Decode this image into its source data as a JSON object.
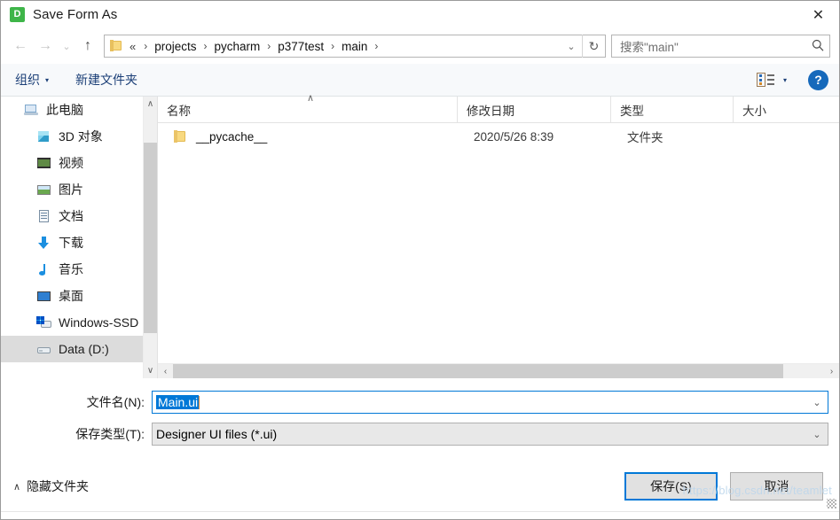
{
  "window": {
    "title": "Save Form As",
    "app_icon": "designer-icon",
    "app_icon_letter": "D",
    "close_label": "✕"
  },
  "nav": {
    "back": "←",
    "forward": "→",
    "history_caret": "⌄",
    "up": "↑",
    "address": {
      "folder_icon": "folder-icon",
      "prefix": "«",
      "crumbs": [
        "projects",
        "pycharm",
        "p377test",
        "main"
      ],
      "separator": "›",
      "dropdown": "⌄"
    },
    "refresh": "↻",
    "search": {
      "placeholder": "搜索\"main\"",
      "icon": "search-icon"
    }
  },
  "toolbar": {
    "organize": "组织",
    "organize_caret": "▾",
    "new_folder": "新建文件夹",
    "view_caret": "▾",
    "help": "?"
  },
  "sidebar": {
    "items": [
      {
        "label": "此电脑",
        "icon": "computer-icon",
        "indent": false,
        "selected": false
      },
      {
        "label": "3D 对象",
        "icon": "3d-objects-icon",
        "indent": true,
        "selected": false
      },
      {
        "label": "视频",
        "icon": "videos-icon",
        "indent": true,
        "selected": false
      },
      {
        "label": "图片",
        "icon": "pictures-icon",
        "indent": true,
        "selected": false
      },
      {
        "label": "文档",
        "icon": "documents-icon",
        "indent": true,
        "selected": false
      },
      {
        "label": "下载",
        "icon": "downloads-icon",
        "indent": true,
        "selected": false
      },
      {
        "label": "音乐",
        "icon": "music-icon",
        "indent": true,
        "selected": false
      },
      {
        "label": "桌面",
        "icon": "desktop-icon",
        "indent": true,
        "selected": false
      },
      {
        "label": "Windows-SSD (",
        "icon": "windows-drive-icon",
        "indent": true,
        "selected": false
      },
      {
        "label": "Data (D:)",
        "icon": "drive-icon",
        "indent": true,
        "selected": true
      }
    ],
    "scroll_up": "∧",
    "scroll_down": "∨"
  },
  "filelist": {
    "columns": [
      {
        "label": "名称",
        "sorted": true,
        "sort_caret": "∧"
      },
      {
        "label": "修改日期",
        "sorted": false
      },
      {
        "label": "类型",
        "sorted": false
      },
      {
        "label": "大小",
        "sorted": false
      }
    ],
    "rows": [
      {
        "icon": "folder-icon",
        "name": "__pycache__",
        "date": "2020/5/26 8:39",
        "type": "文件夹",
        "size": ""
      }
    ],
    "scroll_left": "‹",
    "scroll_right": "›"
  },
  "form": {
    "filename_label": "文件名(N):",
    "filename_value": "Main.ui",
    "filetype_label": "保存类型(T):",
    "filetype_value": "Designer UI files (*.ui)",
    "dropdown_caret": "⌄"
  },
  "footer": {
    "hide_folders_caret": "∧",
    "hide_folders": "隐藏文件夹",
    "save_button": "保存(S)",
    "cancel_button": "取消",
    "watermark": "https://blog.csdn.net/teamlet"
  },
  "colors": {
    "accent": "#0078d7",
    "selection": "#0078d7",
    "command_text": "#1b3f77",
    "app_icon_green": "#3eb549",
    "folder_yellow": "#f8d980"
  }
}
